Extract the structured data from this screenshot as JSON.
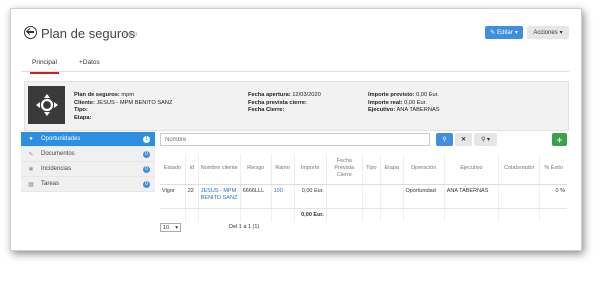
{
  "header": {
    "title": "Plan de seguros",
    "subtitle": "mpm",
    "edit_label": "Editar",
    "actions_label": "Acciones"
  },
  "tabs": [
    {
      "label": "Principal"
    },
    {
      "label": "+Datos"
    }
  ],
  "info": {
    "col1": [
      {
        "label": "Plan de seguros:",
        "value": "mpm"
      },
      {
        "label": "Cliente:",
        "value": "JESUS - MPM BENITO SANZ"
      },
      {
        "label": "Tipo:",
        "value": ""
      },
      {
        "label": "Etapa:",
        "value": ""
      }
    ],
    "col2": [
      {
        "label": "Fecha apertura:",
        "value": "12/03/2020"
      },
      {
        "label": "Fecha prevista cierre:",
        "value": ""
      },
      {
        "label": "Fecha Cierre:",
        "value": ""
      }
    ],
    "col3": [
      {
        "label": "Importe previsto:",
        "value": "0,00 Eur."
      },
      {
        "label": "Importe real:",
        "value": "0,00 Eur."
      },
      {
        "label": "Ejecutivo:",
        "value": "ANA TABERNAS"
      }
    ]
  },
  "sidebar": {
    "items": [
      {
        "label": "Oportunidades",
        "count": "1",
        "icon": "circle-icon"
      },
      {
        "label": "Documentos",
        "count": "0",
        "icon": "paperclip-icon"
      },
      {
        "label": "Incidencias",
        "count": "0",
        "icon": "wrench-icon"
      },
      {
        "label": "Tareas",
        "count": "0",
        "icon": "calendar-icon"
      }
    ]
  },
  "search": {
    "placeholder": "Nombre"
  },
  "table": {
    "headers": [
      "Estado",
      "Id",
      "Nombre cliente",
      "Riesgo",
      "Ramo",
      "Importe",
      "Fecha Prevista Cierre",
      "Tipo",
      "Etapa",
      "Operación",
      "Ejecutivo",
      "Colaborador",
      "% Éxito"
    ],
    "row": {
      "estado": "Vigor",
      "id": "22",
      "cliente": "JESUS - MPM BENITO SANZ",
      "riesgo": "6666LLL",
      "ramo": "100",
      "importe": "0,00 Eur.",
      "fecha": "",
      "tipo": "",
      "etapa": "",
      "operacion": "Oportunidad",
      "ejecutivo": "ANA TABERNAS",
      "colaborador": "",
      "exito": "0 %"
    },
    "total": "0,00 Eur."
  },
  "pager": {
    "page_size": "10",
    "summary": "Del 1 a 1 (1)"
  },
  "colors": {
    "primary": "#3f8fe0",
    "active_tab": "#d0201b",
    "add": "#3ba24b"
  }
}
